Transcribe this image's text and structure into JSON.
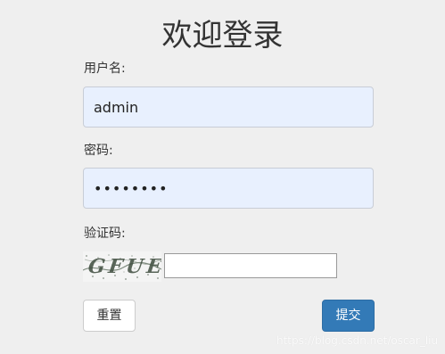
{
  "form": {
    "title": "欢迎登录",
    "username_label": "用户名:",
    "username_value": "admin",
    "password_label": "密码:",
    "password_value": "12345678",
    "captcha_label": "验证码:",
    "captcha_text": "GFUE",
    "captcha_value": "",
    "reset_label": "重置",
    "submit_label": "提交"
  },
  "watermark": "https://blog.csdn.net/oscar_liu",
  "colors": {
    "background": "#efefef",
    "field_autofill": "#e8f0fe",
    "submit_button": "#337ab7"
  }
}
